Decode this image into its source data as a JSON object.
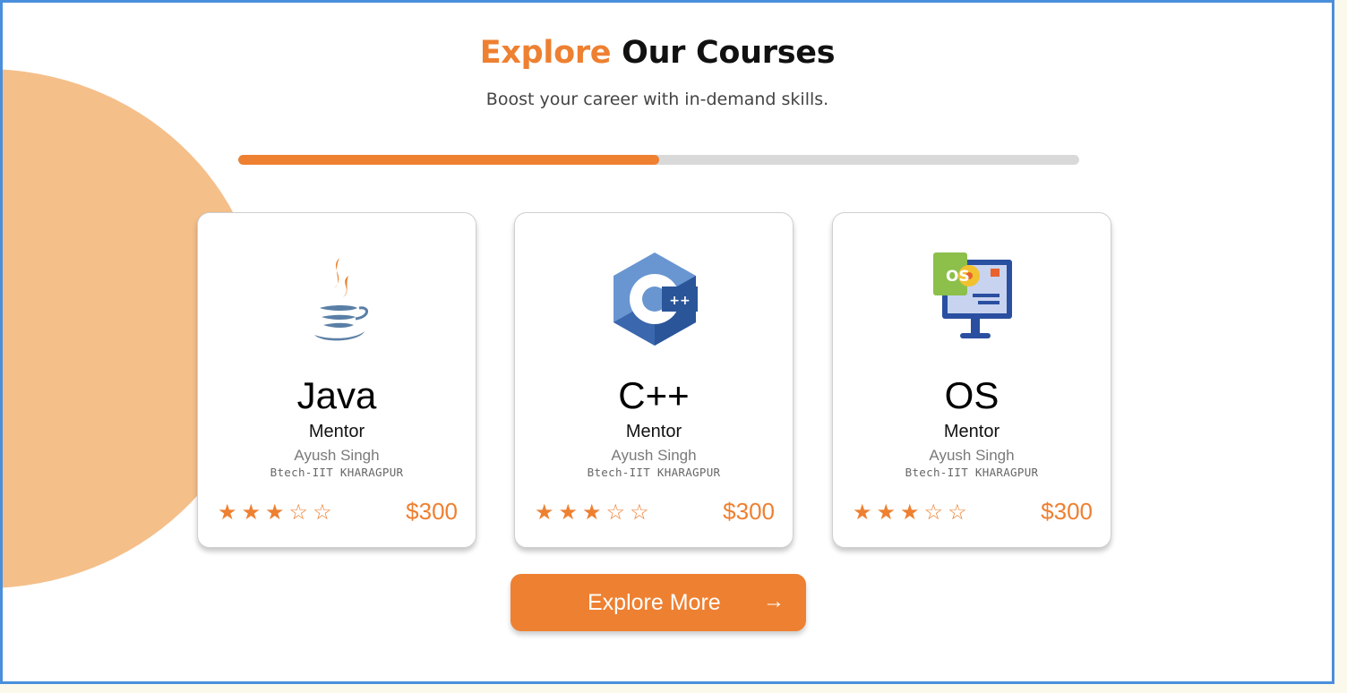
{
  "heading": {
    "accent": "Explore",
    "rest": "Our Courses"
  },
  "subtitle": "Boost your career with in-demand skills.",
  "progress": {
    "fraction": 0.5
  },
  "courses": [
    {
      "title": "Java",
      "role": "Mentor",
      "mentor": "Ayush Singh",
      "degree": "Btech-IIT KHARAGPUR",
      "stars": "★★★☆☆",
      "rating": 3,
      "max_rating": 5,
      "price": "$300",
      "icon": "java-logo-icon"
    },
    {
      "title": "C++",
      "role": "Mentor",
      "mentor": "Ayush Singh",
      "degree": "Btech-IIT KHARAGPUR",
      "stars": "★★★☆☆",
      "rating": 3,
      "max_rating": 5,
      "price": "$300",
      "icon": "cpp-logo-icon"
    },
    {
      "title": "OS",
      "role": "Mentor",
      "mentor": "Ayush Singh",
      "degree": "Btech-IIT KHARAGPUR",
      "stars": "★★★☆☆",
      "rating": 3,
      "max_rating": 5,
      "price": "$300",
      "icon": "os-monitor-icon"
    }
  ],
  "cta": {
    "label": "Explore More",
    "arrow": "→"
  },
  "colors": {
    "accent": "#ee8031",
    "blob": "#f5bf8a",
    "border": "#4a8fdc",
    "track": "#d9d9d9"
  }
}
